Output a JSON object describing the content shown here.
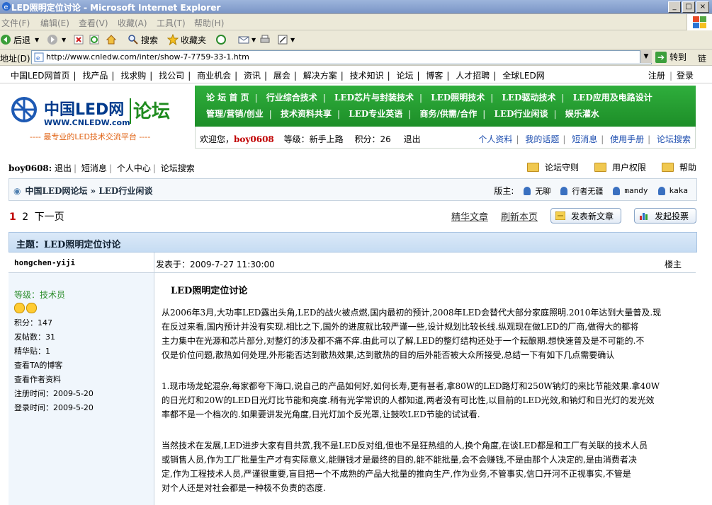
{
  "window": {
    "title": "LED照明定位讨论 - Microsoft Internet Explorer",
    "min": "_",
    "max": "□",
    "close": "×"
  },
  "menu": [
    "文件(F)",
    "编辑(E)",
    "查看(V)",
    "收藏(A)",
    "工具(T)",
    "帮助(H)"
  ],
  "toolbar": {
    "back": "后退",
    "search": "搜索",
    "favorites": "收藏夹"
  },
  "address": {
    "label": "地址(D)",
    "url": "http://www.cnledw.com/inter/show-7-7759-33-1.htm",
    "go": "转到",
    "links": "链接"
  },
  "topnav": {
    "items": [
      "中国LED网首页",
      "找产品",
      "找求购",
      "找公司",
      "商业机会",
      "资讯",
      "展会",
      "解决方案",
      "技术知识",
      "论坛",
      "博客",
      "人才招聘",
      "全球LED网"
    ],
    "register": "注册",
    "login": "登录"
  },
  "logo": {
    "name": "中国LED网",
    "sub": "WWW.CNLEDW.com",
    "forum": "论坛",
    "slogan": "---- 最专业的LED技术交流平台 ----"
  },
  "forum_nav": {
    "row1": [
      "论 坛 首 页",
      "行业综合技术",
      "LED芯片与封装技术",
      "LED照明技术",
      "LED驱动技术",
      "LED应用及电路设计"
    ],
    "row2": [
      "管理/营销/创业",
      "技术资料共享",
      "LED专业英语",
      "商务/供需/合作",
      "LED行业闲谈",
      "娱乐灌水"
    ]
  },
  "userbar": {
    "welcome": "欢迎您，",
    "username": "boy0608",
    "level": "等级：新手上路",
    "points": "积分：26",
    "logout": "退出",
    "links": [
      "个人资料",
      "我的话题",
      "短消息",
      "使用手册",
      "论坛搜索"
    ]
  },
  "subnav": {
    "user": "boy0608:",
    "items": [
      "退出",
      "短消息",
      "个人中心",
      "论坛搜索"
    ]
  },
  "rlinks": [
    "论坛守则",
    "用户权限",
    "帮助"
  ],
  "crumb": {
    "path": "中国LED网论坛 » LED行业闲谈",
    "mods_label": "版主:",
    "mods": [
      "无聊",
      "行者无疆",
      "mandy",
      "kaka"
    ]
  },
  "pager": {
    "p1": "1",
    "p2": "2",
    "next": "下一页"
  },
  "actions": {
    "digest": "精华文章",
    "refresh": "刷新本页",
    "new_topic": "发表新文章",
    "new_poll": "发起投票"
  },
  "topic": {
    "title": "主题：LED照明定位讨论"
  },
  "post": {
    "author": "hongchen-yiji",
    "time": "发表于：2009-7-27 11:30:00",
    "floor": "楼主",
    "rank": "等级：技术员",
    "points": "积分：147",
    "posts": "发帖数：31",
    "digest": "精华贴：1",
    "blog": "查看TA的博客",
    "profile": "查看作者资料",
    "reg": "注册时间：2009-5-20",
    "last": "登录时间：2009-5-20",
    "title": "LED照明定位讨论",
    "para1": [
      "从2006年3月,大功率LED露出头角,LED的战火被点燃,国内最初的预计,2008年LED会替代大部分家庭照明.2010年达到大量普及.现",
      "在反过来看,国内预计并没有实现.相比之下,国外的进度就比较严谨一些,设计规划比较长线.纵观现在做LED的厂商,做得大的都将",
      "主力集中在光源和芯片部分,对整灯的涉及都不痛不痒.由此可以了解,LED的整灯结构还处于一个耘酿期.想快速普及是不可能的.不",
      "仅是价位问题,散热如何处理,外形能否达到散热效果,达到散热的目的后外能否被大众所接受,总结一下有如下几点需要确认"
    ],
    "para2": [
      "1.现市场龙蛇混杂,每家都夸下海口,说自己的产品如何好,如何长寿,更有甚者,拿80W的LED路灯和250W钠灯的来比节能效果.拿40W",
      "的日光灯和20W的LED日光灯比节能和亮度.稍有光学常识的人都知道,两者没有可比性,以目前的LED光效,和钠灯和日光灯的发光效",
      "率都不是一个档次的.如果要讲发光角度,日光灯加个反光罩,让鼓吹LED节能的试试看."
    ],
    "para3": [
      "当然技术在发展,LED进步大家有目共赏,我不是LED反对组,但也不是狂热组的人,换个角度,在谈LED都是和工厂有关联的技术人员",
      "或销售人员,作为工厂批量生产才有实际意义,能赚钱才是最终的目的,能不能批量,会不会赚钱,不是由那个人决定的,是由消费者决",
      "定,作为工程技术人员,严谨很重要,盲目把一个不成熟的产品大批量的推向生产,作为业务,不管事实,信口开河不正视事实,不管是",
      "对个人还是对社会都是一种极不负责的态度."
    ]
  }
}
